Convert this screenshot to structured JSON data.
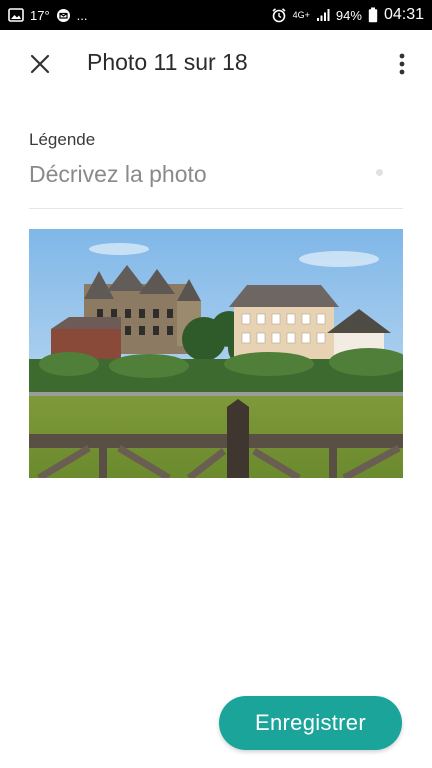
{
  "status_bar": {
    "temperature": "17°",
    "more_notifications": "...",
    "network_type": "4G+",
    "battery": "94%",
    "time": "04:31"
  },
  "app_bar": {
    "title": "Photo 11 sur 18",
    "close_icon": "close-icon",
    "more_icon": "more-vertical-icon"
  },
  "caption": {
    "label": "Légende",
    "placeholder": "Décrivez la photo",
    "value": ""
  },
  "photo": {
    "subject": "photo"
  },
  "actions": {
    "save_label": "Enregistrer"
  },
  "colors": {
    "accent": "#1aa49a",
    "status_bar": "#000000"
  }
}
